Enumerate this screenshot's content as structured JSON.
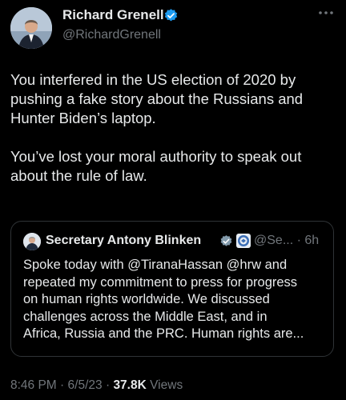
{
  "author": {
    "name": "Richard Grenell",
    "handle": "@RichardGrenell"
  },
  "icons": {
    "more": "more-options-icon",
    "verified": "verified-badge-icon",
    "government_seal": "us-seal-icon"
  },
  "tweet": {
    "text": "You interfered in the US election of 2020 by\npushing a fake story about the Russians and\nHunter Biden’s laptop.\n\nYou’ve lost your moral authority to speak out\nabout the rule of law."
  },
  "quoted": {
    "name": "Secretary Antony Blinken",
    "handle": "@Se...",
    "separator": "·",
    "time": "6h",
    "text": "Spoke today with @TiranaHassan @hrw and\nrepeated my commitment to press for progress\non human rights worldwide. We discussed\nchallenges across the Middle East, and in\nAfrica, Russia and the PRC. Human rights are..."
  },
  "meta": {
    "time": "8:46 PM",
    "sep1": "·",
    "date": "6/5/23",
    "sep2": "·",
    "views_count": "37.8K",
    "views_label": "Views"
  },
  "colors": {
    "background": "#000000",
    "text": "#e7e9ea",
    "secondary": "#71767b",
    "verified_blue": "#1d9bf0",
    "border": "#2f3336"
  }
}
